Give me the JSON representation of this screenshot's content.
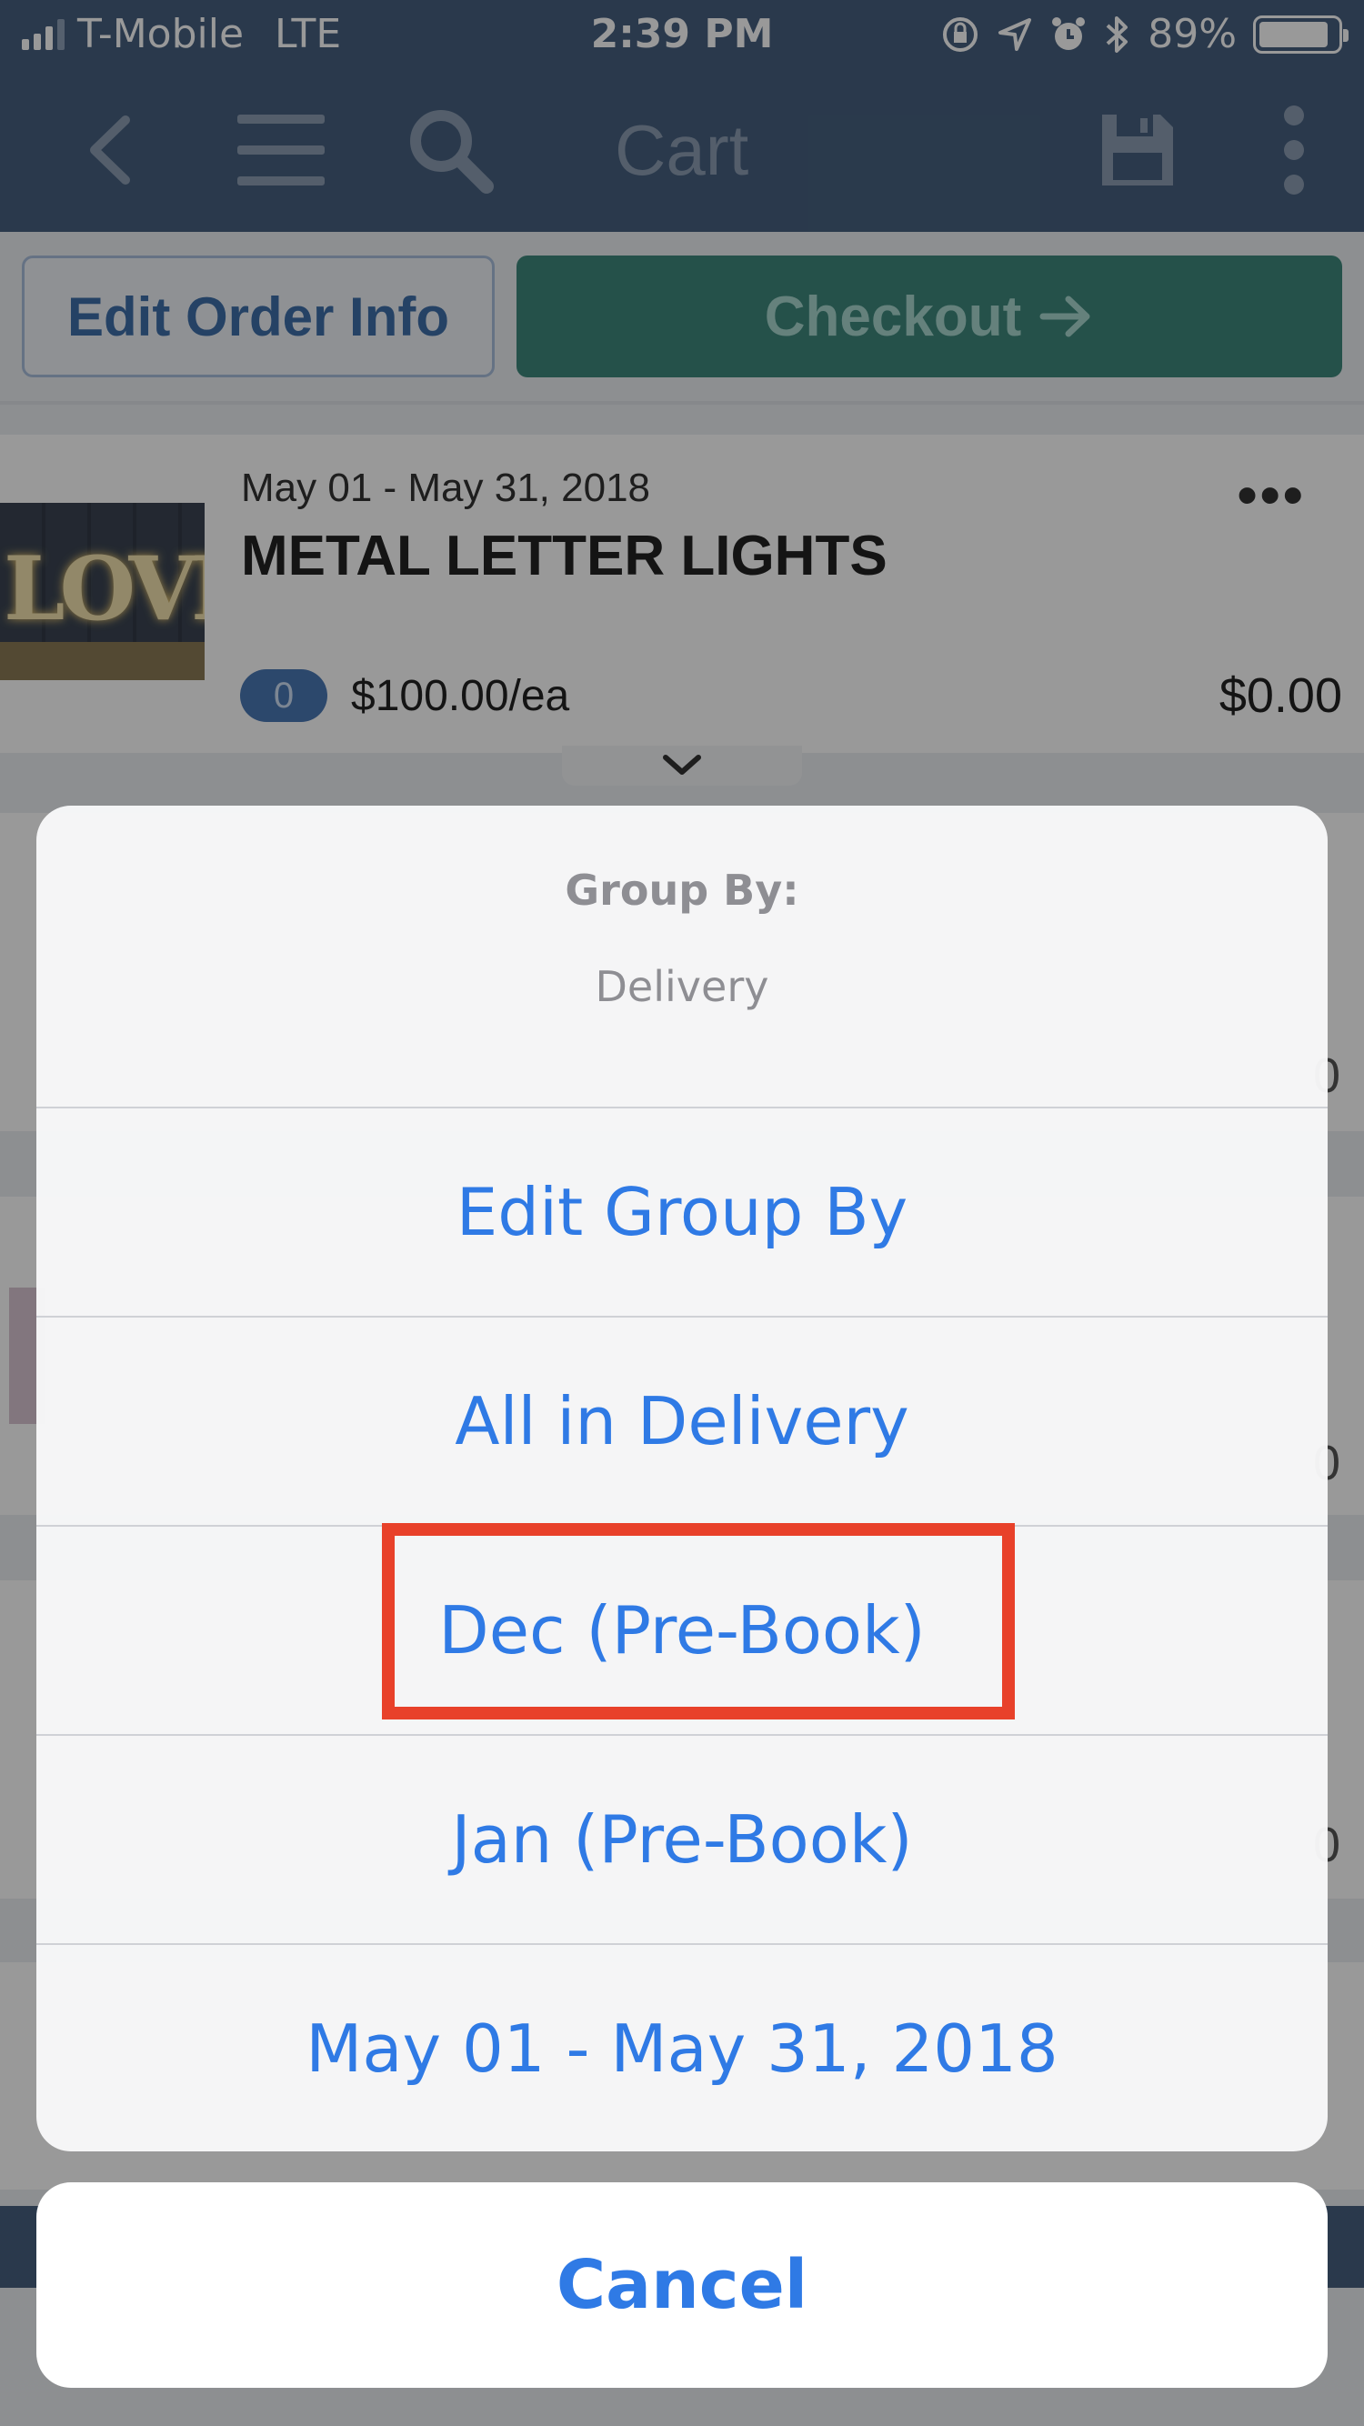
{
  "status_bar": {
    "carrier": "T-Mobile",
    "network": "LTE",
    "time": "2:39 PM",
    "battery": "89%",
    "battery_level": 0.89,
    "icons": [
      "signal-icon",
      "orientation-lock-icon",
      "location-icon",
      "alarm-icon",
      "bluetooth-icon",
      "battery-icon"
    ]
  },
  "navbar": {
    "title": "Cart",
    "icons": [
      "back-icon",
      "menu-icon",
      "search-icon",
      "save-icon",
      "more-vertical-icon"
    ]
  },
  "actions": {
    "edit_order_info": "Edit Order Info",
    "checkout": "Checkout"
  },
  "cart_item": {
    "date_range": "May 01 - May 31, 2018",
    "title": "METAL LETTER LIGHTS",
    "quantity": "0",
    "unit_price": "$100.00/ea",
    "total": "$0.00",
    "more": "•••",
    "thumb_letters": "LOVE"
  },
  "action_sheet": {
    "heading": "Group By:",
    "subtitle": "Delivery",
    "options": [
      "Edit Group By",
      "All in Delivery",
      "Dec (Pre-Book)",
      "Jan (Pre-Book)",
      "May 01 - May 31, 2018"
    ],
    "highlighted_option": "Dec (Pre-Book)",
    "cancel": "Cancel"
  },
  "colors": {
    "header": "#46607f",
    "checkout": "#3e887c",
    "ios_blue": "#2f7ae5",
    "highlight": "#e8412a"
  }
}
